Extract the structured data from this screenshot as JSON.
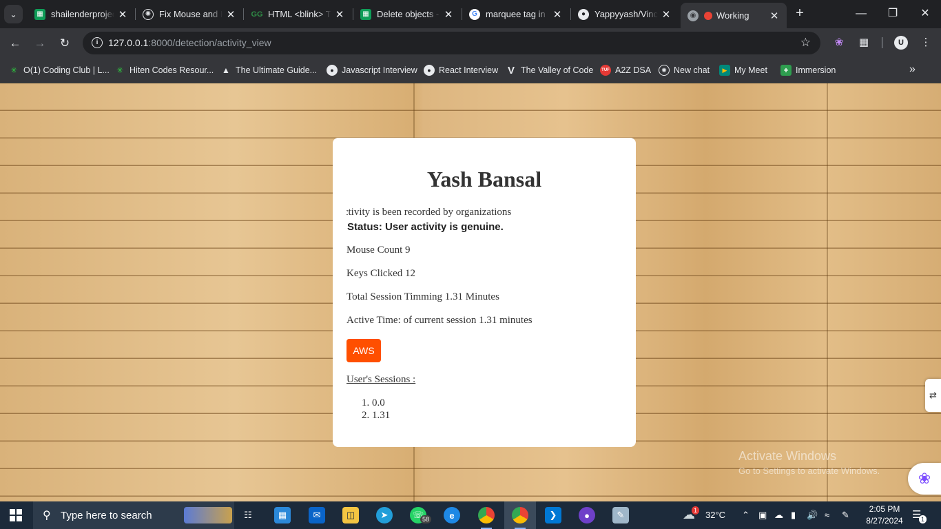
{
  "browser": {
    "tabs": [
      {
        "title": "shailenderprojec",
        "icon": "sheets-icon",
        "color": "#0f9d58"
      },
      {
        "title": "Fix Mouse and K",
        "icon": "openai-icon",
        "color": "#e8eaed"
      },
      {
        "title": "HTML <blink> T",
        "icon": "geeksforgeeks-icon",
        "color": "#2f8d46"
      },
      {
        "title": "Delete objects -",
        "icon": "sheets-icon",
        "color": "#0f9d58"
      },
      {
        "title": "marquee tag in",
        "icon": "google-icon",
        "color": "#4285f4"
      },
      {
        "title": "Yappyyash/Vinc",
        "icon": "github-icon",
        "color": "#e8eaed"
      },
      {
        "title": "Working",
        "icon": "globe-icon",
        "color": "#9aa0a6",
        "recording": true
      }
    ],
    "url": {
      "host": "127.0.0.1",
      "rest": ":8000/detection/activity_view"
    },
    "bookmarks": [
      {
        "label": "O(1) Coding Club | L...",
        "icon": "star-icon",
        "color": "#2ecc40"
      },
      {
        "label": "Hiten Codes Resour...",
        "icon": "star-icon",
        "color": "#2ecc40"
      },
      {
        "label": "The Ultimate Guide...",
        "icon": "mountain-icon",
        "color": "#e8eaed"
      },
      {
        "label": "Javascript Interview",
        "icon": "github-icon",
        "color": "#e8eaed"
      },
      {
        "label": "React Interview",
        "icon": "github-icon",
        "color": "#e8eaed"
      },
      {
        "label": "The Valley of Code",
        "icon": "v-logo-icon",
        "color": "#e8eaed"
      },
      {
        "label": "A2Z DSA",
        "icon": "tuf-icon",
        "color": "#e53935"
      },
      {
        "label": "New chat",
        "icon": "openai-icon",
        "color": "#e8eaed"
      },
      {
        "label": "My Meet",
        "icon": "meet-icon",
        "color": "#00897b"
      },
      {
        "label": "Immersion",
        "icon": "plus-square-icon",
        "color": "#2e9e4f"
      }
    ]
  },
  "page": {
    "name": "Yash Bansal",
    "marquee_text": "Activity is been recorded by organizations",
    "status": "Status: User activity is genuine.",
    "mouse_count": "Mouse Count 9",
    "keys_clicked": "Keys Clicked 12",
    "session_timing": "Total Session Timming 1.31 Minutes",
    "active_time": "Active Time: of current session 1.31 minutes",
    "aws_button": "AWS",
    "sessions_title": "User's Sessions :",
    "sessions": [
      "1. 0.0",
      "2. 1.31"
    ],
    "accent_color": "#ff4f00"
  },
  "watermark": {
    "line1": "Activate Windows",
    "line2": "Go to Settings to activate Windows."
  },
  "taskbar": {
    "search_placeholder": "Type here to search",
    "whatsapp_badge": "58",
    "weather": "32°C",
    "time": "2:05 PM",
    "date": "8/27/2024",
    "notification_count": "1"
  }
}
